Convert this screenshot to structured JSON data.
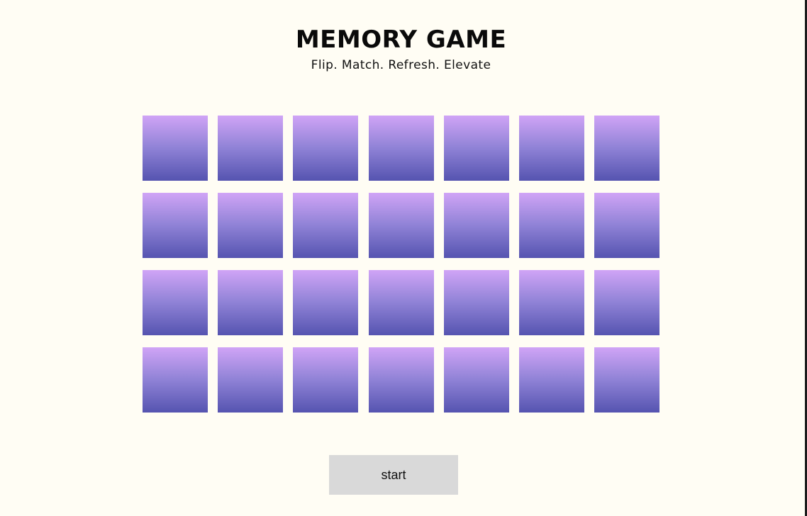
{
  "header": {
    "title": "MEMORY GAME",
    "subtitle": "Flip. Match. Refresh. Elevate"
  },
  "board": {
    "rows": 4,
    "columns": 7,
    "card_count": 28,
    "face_down_gradient": [
      "#d0a4f6",
      "#5554b0"
    ]
  },
  "controls": {
    "start_label": "start"
  },
  "colors": {
    "background": "#fffdf4",
    "button": "#d9d9d9"
  }
}
